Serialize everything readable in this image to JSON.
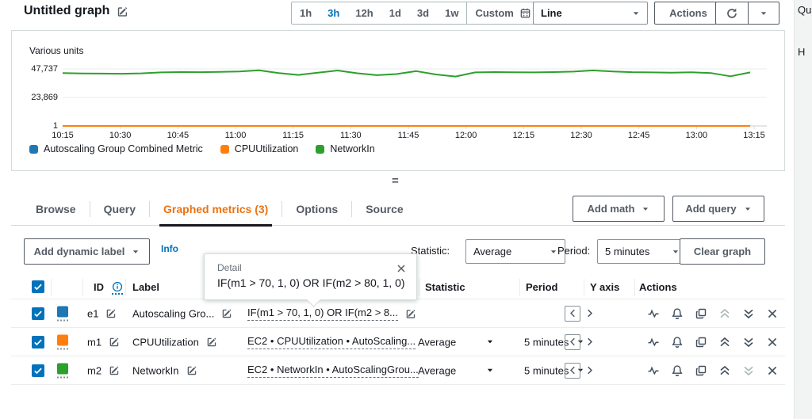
{
  "header": {
    "title": "Untitled graph",
    "time_ranges": [
      "1h",
      "3h",
      "12h",
      "1d",
      "3d",
      "1w"
    ],
    "active_range": "3h",
    "custom_label": "Custom",
    "line_type": "Line",
    "actions_label": "Actions"
  },
  "right_panel": {
    "text_top": "Qu",
    "text_mid": "H"
  },
  "divider_handle": "=",
  "chart_data": {
    "type": "line",
    "ylabel": "Various units",
    "ylim": [
      1,
      47737
    ],
    "yticks": [
      1,
      23869,
      47737
    ],
    "ytick_labels": [
      "1",
      "23,869",
      "47,737"
    ],
    "x_labels": [
      "10:15",
      "10:30",
      "10:45",
      "11:00",
      "11:15",
      "11:30",
      "11:45",
      "12:00",
      "12:15",
      "12:30",
      "12:45",
      "13:00",
      "13:15"
    ],
    "grid": true,
    "legend_position": "bottom",
    "series": [
      {
        "name": "Autoscaling Group Combined Metric",
        "color": "#1f77b4",
        "values": [
          0,
          0,
          0,
          0,
          0,
          0,
          0,
          0,
          0,
          0,
          0,
          0,
          0,
          0,
          0,
          0,
          0,
          0,
          0,
          0,
          0,
          0,
          0,
          0,
          0,
          0,
          0,
          0,
          0,
          0,
          0,
          0,
          0,
          0,
          0,
          0
        ]
      },
      {
        "name": "CPUUtilization",
        "color": "#ff7f0e",
        "values": [
          2.4,
          2.6,
          2.3,
          2.5,
          2.8,
          2.4,
          2.2,
          2.5,
          2.7,
          2.4,
          2.3,
          2.6,
          2.5,
          2.4,
          2.6,
          2.8,
          2.5,
          2.3,
          2.4,
          2.6,
          2.5,
          2.4,
          2.7,
          2.5,
          2.3,
          2.6,
          2.4,
          2.5,
          2.8,
          2.6,
          2.4,
          2.5,
          2.3,
          2.6,
          2.5,
          2.4
        ]
      },
      {
        "name": "NetworkIn",
        "color": "#2ca02c",
        "values": [
          44200,
          43900,
          43800,
          43700,
          44000,
          44800,
          45100,
          45000,
          45200,
          45600,
          46600,
          44300,
          42700,
          44600,
          46400,
          44100,
          42500,
          43400,
          45900,
          43100,
          41400,
          44800,
          45100,
          44900,
          44800,
          45100,
          45500,
          46500,
          45600,
          45000,
          44800,
          44600,
          44900,
          44300,
          41600,
          44800
        ]
      }
    ]
  },
  "tabs": [
    {
      "label": "Browse"
    },
    {
      "label": "Query"
    },
    {
      "label": "Graphed metrics (3)",
      "active": true
    },
    {
      "label": "Options"
    },
    {
      "label": "Source"
    }
  ],
  "tab_actions": {
    "add_math": "Add math",
    "add_query": "Add query"
  },
  "toolbar": {
    "add_dynamic_label": "Add dynamic label",
    "info": "Info",
    "statistic_label": "Statistic:",
    "statistic_value": "Average",
    "period_label": "Period:",
    "period_value": "5 minutes",
    "clear_graph": "Clear graph"
  },
  "tooltip": {
    "title": "Detail",
    "content": "IF(m1 > 70, 1, 0) OR IF(m2 > 80, 1, 0)"
  },
  "table": {
    "headers": {
      "id": "ID",
      "label": "Label",
      "statistic": "Statistic",
      "period": "Period",
      "y_axis": "Y axis",
      "actions": "Actions"
    },
    "rows": [
      {
        "id": "e1",
        "color": "#1f77b4",
        "label": "Autoscaling Gro...",
        "details": "IF(m1 > 70, 1, 0) OR IF(m2 > 8...",
        "statistic": "",
        "period": ""
      },
      {
        "id": "m1",
        "color": "#ff7f0e",
        "label": "CPUUtilization",
        "details": "EC2 • CPUUtilization • AutoScaling...",
        "statistic": "Average",
        "period": "5 minutes"
      },
      {
        "id": "m2",
        "color": "#2ca02c",
        "label": "NetworkIn",
        "details": "EC2 • NetworkIn • AutoScalingGrou...",
        "statistic": "Average",
        "period": "5 minutes"
      }
    ]
  },
  "icons": {
    "edit-icon": "pencil-square",
    "calendar-icon": "calendar-grid",
    "refresh-icon": "circular-arrow",
    "caret-down-icon": "filled-triangle-down",
    "info-circle-icon": "circled-i",
    "close-icon": "x-cross",
    "check-icon": "checkmark",
    "pulse-icon": "heartbeat-line",
    "bell-icon": "alarm-bell",
    "copy-icon": "overlapping-squares",
    "chevrons-up-icon": "double-chevron-up",
    "chevrons-down-icon": "double-chevron-down",
    "chevron-left-icon": "angle-left",
    "chevron-right-icon": "angle-right"
  }
}
